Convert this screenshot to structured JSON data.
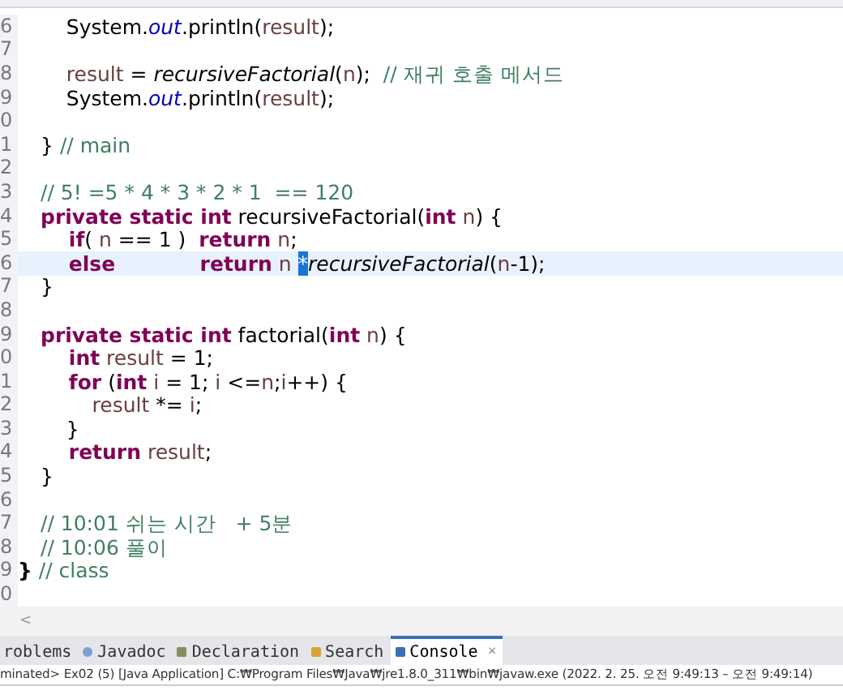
{
  "editor": {
    "lines": [
      {
        "number": "6",
        "current": false,
        "tokens": [
          {
            "kind": "plain",
            "text": "    System."
          },
          {
            "kind": "field",
            "text": "out"
          },
          {
            "kind": "plain",
            "text": ".println("
          },
          {
            "kind": "var",
            "text": "result"
          },
          {
            "kind": "plain",
            "text": ");"
          }
        ]
      },
      {
        "number": "7",
        "current": false
      },
      {
        "number": "8",
        "current": false,
        "tokens": [
          {
            "kind": "var",
            "text": "    result"
          },
          {
            "kind": "plain",
            "text": " = "
          },
          {
            "kind": "method",
            "text": "recursiveFactorial"
          },
          {
            "kind": "plain",
            "text": "("
          },
          {
            "kind": "var",
            "text": "n"
          },
          {
            "kind": "plain",
            "text": ");  "
          },
          {
            "kind": "comment",
            "text": "// 재귀 호출 메서드"
          }
        ]
      },
      {
        "number": "9",
        "current": false,
        "tokens": [
          {
            "kind": "plain",
            "text": "    System."
          },
          {
            "kind": "field",
            "text": "out"
          },
          {
            "kind": "plain",
            "text": ".println("
          },
          {
            "kind": "var",
            "text": "result"
          },
          {
            "kind": "plain",
            "text": ");"
          }
        ]
      },
      {
        "number": "0",
        "current": false
      },
      {
        "number": "1",
        "current": false,
        "tokens": [
          {
            "kind": "plain",
            "text": "} "
          },
          {
            "kind": "comment",
            "text": "// main"
          }
        ]
      },
      {
        "number": "2",
        "current": false
      },
      {
        "number": "3",
        "current": false,
        "tokens": [
          {
            "kind": "comment",
            "text": "// 5! =5 * 4 * 3 * 2 * 1  == 120"
          }
        ]
      },
      {
        "number": "4",
        "current": false,
        "tokens": [
          {
            "kind": "keyword",
            "text": "private static int"
          },
          {
            "kind": "plain",
            "text": " recursiveFactorial("
          },
          {
            "kind": "keyword",
            "text": "int"
          },
          {
            "kind": "var",
            "text": " n"
          },
          {
            "kind": "plain",
            "text": ") {"
          }
        ]
      },
      {
        "number": "5",
        "current": false,
        "tokens": [
          {
            "kind": "keyword",
            "text": "    if"
          },
          {
            "kind": "plain",
            "text": "( "
          },
          {
            "kind": "var",
            "text": "n"
          },
          {
            "kind": "plain",
            "text": " == 1 )  "
          },
          {
            "kind": "keyword",
            "text": "return"
          },
          {
            "kind": "var",
            "text": " n"
          },
          {
            "kind": "plain",
            "text": ";"
          }
        ]
      },
      {
        "number": "6",
        "current": true,
        "tokens": [
          {
            "kind": "keyword",
            "text": "    else            return"
          },
          {
            "kind": "var",
            "text": " n "
          },
          {
            "kind": "selection",
            "text": "*"
          },
          {
            "kind": "method",
            "text": "recursiveFactorial"
          },
          {
            "kind": "plain",
            "text": "("
          },
          {
            "kind": "var",
            "text": "n"
          },
          {
            "kind": "plain",
            "text": "-1);"
          }
        ]
      },
      {
        "number": "7",
        "current": false,
        "tokens": [
          {
            "kind": "plain",
            "text": "}"
          }
        ]
      },
      {
        "number": "8",
        "current": false
      },
      {
        "number": "9",
        "current": false,
        "tokens": [
          {
            "kind": "keyword",
            "text": "private static int"
          },
          {
            "kind": "plain",
            "text": " factorial("
          },
          {
            "kind": "keyword",
            "text": "int"
          },
          {
            "kind": "var",
            "text": " n"
          },
          {
            "kind": "plain",
            "text": ") {"
          }
        ]
      },
      {
        "number": "0",
        "current": false,
        "tokens": [
          {
            "kind": "keyword",
            "text": "    int"
          },
          {
            "kind": "var",
            "text": " result"
          },
          {
            "kind": "plain",
            "text": " = 1;"
          }
        ]
      },
      {
        "number": "1",
        "current": false,
        "tokens": [
          {
            "kind": "keyword",
            "text": "    for"
          },
          {
            "kind": "plain",
            "text": " ("
          },
          {
            "kind": "keyword",
            "text": "int"
          },
          {
            "kind": "var",
            "text": " i"
          },
          {
            "kind": "plain",
            "text": " = 1; "
          },
          {
            "kind": "var",
            "text": "i"
          },
          {
            "kind": "plain",
            "text": " <="
          },
          {
            "kind": "var",
            "text": "n"
          },
          {
            "kind": "plain",
            "text": ";"
          },
          {
            "kind": "var",
            "text": "i"
          },
          {
            "kind": "plain",
            "text": "++) {"
          }
        ]
      },
      {
        "number": "2",
        "current": false,
        "tokens": [
          {
            "kind": "var",
            "text": "        result"
          },
          {
            "kind": "plain",
            "text": " *= "
          },
          {
            "kind": "var",
            "text": "i"
          },
          {
            "kind": "plain",
            "text": ";"
          }
        ]
      },
      {
        "number": "3",
        "current": false,
        "tokens": [
          {
            "kind": "plain",
            "text": "    }"
          }
        ]
      },
      {
        "number": "4",
        "current": false,
        "tokens": [
          {
            "kind": "keyword",
            "text": "    return"
          },
          {
            "kind": "var",
            "text": " result"
          },
          {
            "kind": "plain",
            "text": ";"
          }
        ]
      },
      {
        "number": "5",
        "current": false,
        "tokens": [
          {
            "kind": "plain",
            "text": "}"
          }
        ]
      },
      {
        "number": "6",
        "current": false
      },
      {
        "number": "7",
        "current": false,
        "tokens": [
          {
            "kind": "comment",
            "text": "// 10:01 쉬는 시간   + 5분"
          }
        ]
      },
      {
        "number": "8",
        "current": false,
        "tokens": [
          {
            "kind": "comment",
            "text": "// 10:06 풀이"
          }
        ]
      },
      {
        "number": "9",
        "current": false,
        "tokens": [
          {
            "kind": "outer",
            "text": "}"
          },
          {
            "kind": "comment",
            "text": " // class"
          }
        ]
      },
      {
        "number": "0",
        "current": false
      }
    ]
  },
  "scroll_arrow": "<",
  "panel_tabs": [
    {
      "label": "roblems",
      "selected": false
    },
    {
      "label": "Javadoc",
      "selected": false
    },
    {
      "label": "Declaration",
      "selected": false
    },
    {
      "label": "Search",
      "selected": false
    },
    {
      "label": "Console",
      "selected": true,
      "close": "×"
    }
  ],
  "console_status": "minated> Ex02 (5) [Java Application] C:₩Program Files₩Java₩jre1.8.0_311₩bin₩javaw.exe  (2022. 2. 25. 오전 9:49:13 – 오전 9:49:14)"
}
